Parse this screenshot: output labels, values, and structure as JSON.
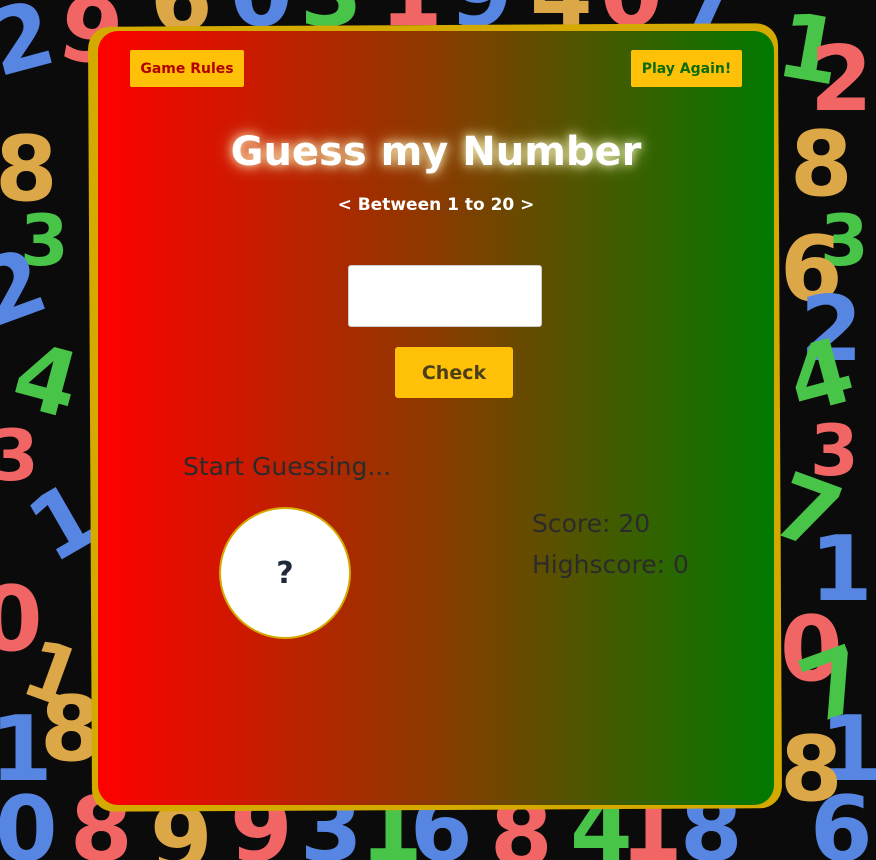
{
  "header": {
    "rules_label": "Game Rules",
    "play_again_label": "Play Again!"
  },
  "title": "Guess my Number",
  "subtitle": "< Between 1 to 20 >",
  "guess_input": {
    "value": "",
    "placeholder": ""
  },
  "check_label": "Check",
  "message": "Start Guessing...",
  "secret_display": "?",
  "score_label": "Score: ",
  "score_value": "20",
  "highscore_label": "Highscore: ",
  "highscore_value": "0",
  "colors": {
    "gradient_start": "#ff0000",
    "gradient_mid": "#8a3a00",
    "gradient_end": "#007a00",
    "button": "#ffc107",
    "card_border": "#d4a900",
    "background": "#0b0b0b"
  }
}
